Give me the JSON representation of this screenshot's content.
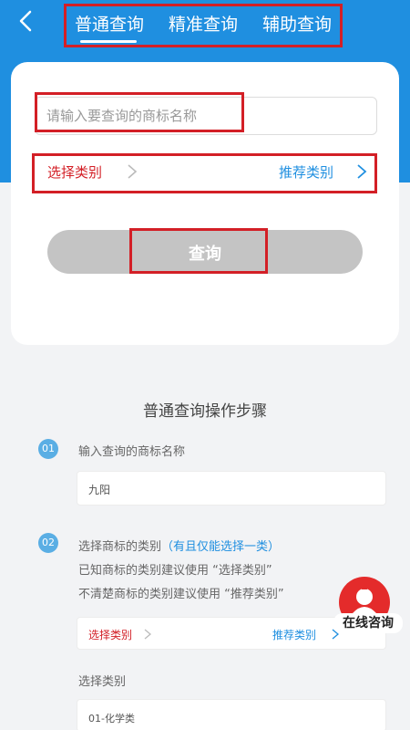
{
  "tabs": [
    "普通查询",
    "精准查询",
    "辅助查询"
  ],
  "search": {
    "placeholder": "请输入要查询的商标名称"
  },
  "category": {
    "select_label": "选择类别",
    "recommend_label": "推荐类别"
  },
  "query_button": "查询",
  "guide": {
    "title": "普通查询操作步骤",
    "step1": {
      "num": "01",
      "text": "输入查询的商标名称",
      "example": "九阳"
    },
    "step2": {
      "num": "02",
      "text": "选择商标的类别",
      "hint": "（有且仅能选择一类）",
      "line2": "已知商标的类别建议使用 “选择类别”",
      "line3": "不清楚商标的类别建议使用 “推荐类别”",
      "select_label": "选择类别",
      "recommend_label": "推荐类别",
      "chosen_title": "选择类别",
      "chosen_value": "01-化学类"
    }
  },
  "fab": {
    "label": "在线咨询"
  },
  "colors": {
    "brand_blue": "#1f8fe0",
    "highlight_red": "#d31f26",
    "button_gray": "#c4c4c4",
    "fab_red": "#e42b2b"
  }
}
